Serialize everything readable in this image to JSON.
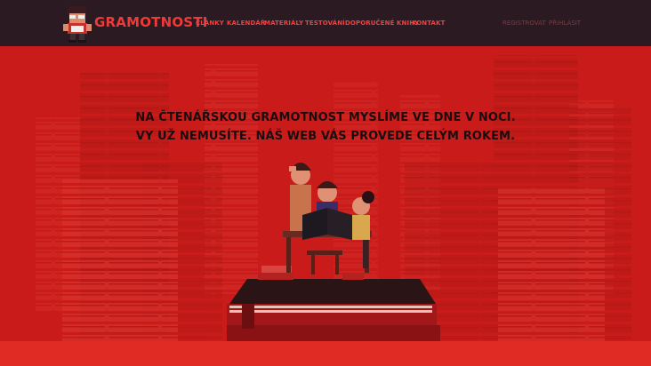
{
  "header": {
    "brand": "GRAMOTNOSTI",
    "nav": [
      "ČLÁNKY",
      "KALENDÁŘ",
      "MATERIÁLY",
      "TESTOVÁNÍ",
      "DOPORUČENÉ KNIHY",
      "KONTAKT"
    ],
    "auth": {
      "register": "REGISTROVAT",
      "login": "PŘIHLÁSIT"
    }
  },
  "hero": {
    "line1": "NA ČTENÁŘSKOU GRAMOTNOST MYSLÍME VE DNE V NOCI.",
    "line2": "VY UŽ NEMUSÍTE. NÁŠ WEB VÁS PROVEDE CELÝM ROKEM."
  },
  "colors": {
    "nav_bg": "#2b1a22",
    "accent": "#ee3b37",
    "hero_bg": "#c91c1a",
    "text_dark": "#1c0c0e"
  },
  "icons": [
    "mascot-logo-icon"
  ]
}
